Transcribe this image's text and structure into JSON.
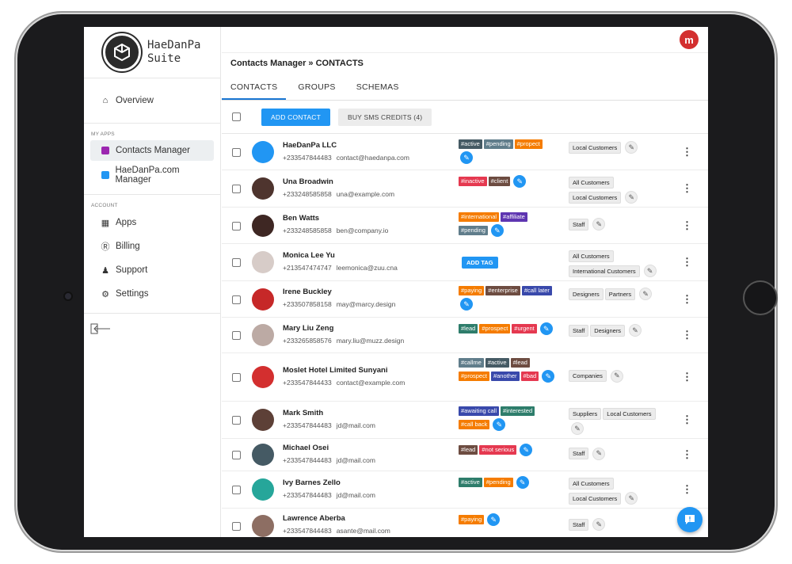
{
  "brand": {
    "name_line1": "HaeDanPa",
    "name_line2": "Suite"
  },
  "sidebar": {
    "overview": "Overview",
    "my_apps_label": "MY APPS",
    "apps": [
      "Contacts Manager",
      "HaeDanPa.com Manager"
    ],
    "account_label": "ACCOUNT",
    "account_items": [
      "Apps",
      "Billing",
      "Support",
      "Settings"
    ]
  },
  "breadcrumb": "Contacts Manager » CONTACTS",
  "tabs": [
    "CONTACTS",
    "GROUPS",
    "SCHEMAS"
  ],
  "toolbar": {
    "add_contact": "ADD CONTACT",
    "buy_sms": "BUY SMS CREDITS (4)"
  },
  "add_tag_label": "ADD TAG",
  "colors": {
    "accent": "#2196f3",
    "brand_red": "#d32f2f"
  },
  "contacts": [
    {
      "name": "HaeDanPa LLC",
      "phone": "+233547844483",
      "email": "contact@haedanpa.com",
      "avatar_color": "#2196f3",
      "tags": [
        [
          "#active",
          "#455a64"
        ],
        [
          "#pending",
          "#607d8b"
        ],
        [
          "#propect",
          "#f57c00"
        ]
      ],
      "groups": [
        "Local Customers"
      ]
    },
    {
      "name": "Una Broadwin",
      "phone": "+233248585858",
      "email": "una@example.com",
      "avatar_color": "#4e342e",
      "tags": [
        [
          "#inactive",
          "#e53950"
        ],
        [
          "#client",
          "#6d4c41"
        ]
      ],
      "groups": [
        "All Customers",
        "Local Customers"
      ]
    },
    {
      "name": "Ben Watts",
      "phone": "+233248585858",
      "email": "ben@company.io",
      "avatar_color": "#3e2723",
      "tags": [
        [
          "#international",
          "#f57c00"
        ],
        [
          "#affiliate",
          "#5e35b1"
        ],
        [
          "#pending",
          "#607d8b"
        ]
      ],
      "groups": [
        "Staff"
      ]
    },
    {
      "name": "Monica Lee Yu",
      "phone": "+213547474747",
      "email": "leemonica@zuu.cna",
      "avatar_color": "#d7ccc8",
      "tags": [],
      "groups": [
        "All Customers",
        "International Customers"
      ]
    },
    {
      "name": "Irene Buckley",
      "phone": "+233507858158",
      "email": "may@marcy.design",
      "avatar_color": "#c62828",
      "tags": [
        [
          "#paying",
          "#f57c00"
        ],
        [
          "#enterprise",
          "#6d4c41"
        ],
        [
          "#call later",
          "#3949ab"
        ]
      ],
      "groups": [
        "Designers",
        "Partners"
      ]
    },
    {
      "name": "Mary Liu Zeng",
      "phone": "+233265858576",
      "email": "mary.liu@muzz.design",
      "avatar_color": "#bcaaa4",
      "tags": [
        [
          "#lead",
          "#2e7d6b"
        ],
        [
          "#prospect",
          "#f57c00"
        ],
        [
          "#urgent",
          "#e53950"
        ]
      ],
      "groups": [
        "Staff",
        "Designers"
      ]
    },
    {
      "name": "Moslet Hotel Limited Sunyani",
      "phone": "+233547844433",
      "email": "contact@example.com",
      "avatar_color": "#d32f2f",
      "tags": [
        [
          "#callme",
          "#607d8b"
        ],
        [
          "#active",
          "#455a64"
        ],
        [
          "#lead",
          "#6d4c41"
        ],
        [
          "#prospect",
          "#f57c00"
        ],
        [
          "#another",
          "#3949ab"
        ],
        [
          "#bad",
          "#e53950"
        ]
      ],
      "groups": [
        "Companies"
      ]
    },
    {
      "name": "Mark Smith",
      "phone": "+233547844483",
      "email": "jd@mail.com",
      "avatar_color": "#5d4037",
      "tags": [
        [
          "#awaiting call",
          "#3949ab"
        ],
        [
          "#interested",
          "#2e7d6b"
        ],
        [
          "#call back",
          "#f57c00"
        ]
      ],
      "groups": [
        "Suppliers",
        "Local Customers"
      ]
    },
    {
      "name": "Michael Osei",
      "phone": "+233547844483",
      "email": "jd@mail.com",
      "avatar_color": "#455a64",
      "tags": [
        [
          "#lead",
          "#6d4c41"
        ],
        [
          "#not serious",
          "#e53950"
        ]
      ],
      "groups": [
        "Staff"
      ]
    },
    {
      "name": "Ivy Barnes Zello",
      "phone": "+233547844483",
      "email": "jd@mail.com",
      "avatar_color": "#26a69a",
      "tags": [
        [
          "#active",
          "#2e7d6b"
        ],
        [
          "#pending",
          "#f57c00"
        ]
      ],
      "groups": [
        "All Customers",
        "Local Customers"
      ]
    },
    {
      "name": "Lawrence Aberba",
      "phone": "+233547844483",
      "email": "asante@mail.com",
      "avatar_color": "#8d6e63",
      "tags": [
        [
          "#paying",
          "#f57c00"
        ]
      ],
      "groups": [
        "Staff"
      ]
    }
  ]
}
